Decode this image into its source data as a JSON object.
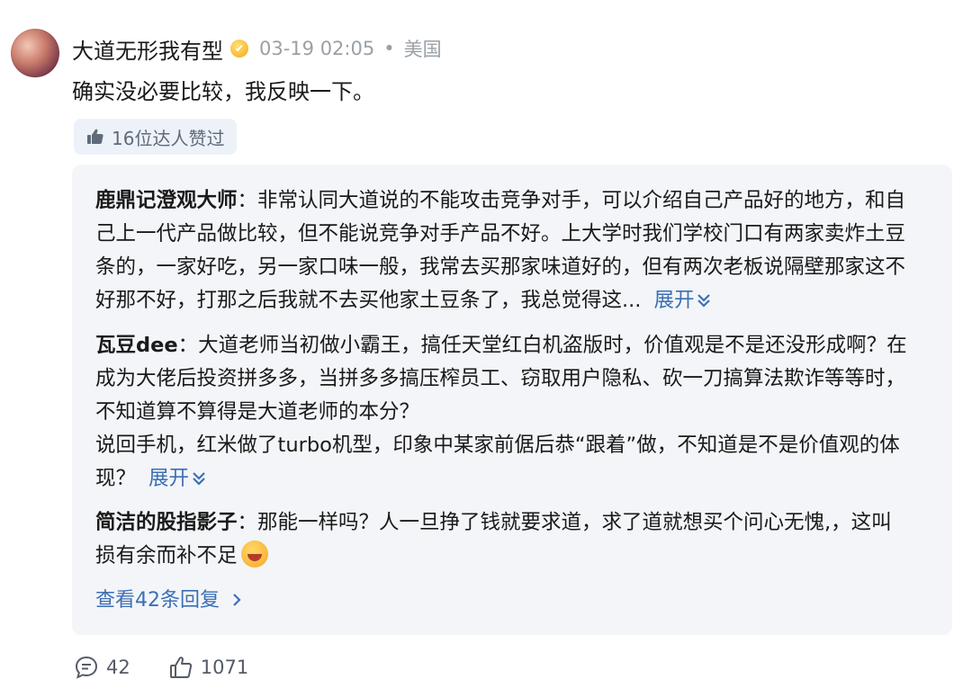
{
  "comment": {
    "username": "大道无形我有型",
    "timestamp": "03-19 02:05",
    "separator": "•",
    "location": "美国",
    "text": "确实没必要比较，我反映一下。",
    "likes_by_experts": "16位达人赞过"
  },
  "replies": [
    {
      "author": "鹿鼎记澄观大师",
      "separator": "：",
      "lines": [
        "非常认同大道说的不能攻击竞争对手，可以介绍自己产品好的地方，和自",
        "己上一代产品做比较，但不能说竞争对手产品不好。上大学时我们学校门口有两家卖炸土豆",
        "条的，一家好吃，另一家口味一般，我常去买那家味道好的，但有两次老板说隔壁那家这不",
        "好那不好，打那之后我就不去买他家土豆条了，我总觉得这..."
      ],
      "expand_label": "展开"
    },
    {
      "author": "瓦豆dee",
      "separator": "：",
      "lines": [
        "大道老师当初做小霸王，搞任天堂红白机盗版时，价值观是不是还没形成啊？在",
        "成为大佬后投资拼多多，当拼多多搞压榨员工、窃取用户隐私、砍一刀搞算法欺诈等等时，",
        "不知道算不算得是大道老师的本分？",
        "说回手机，红米做了turbo机型，印象中某家前倨后恭“跟着”做，不知道是不是价值观的体",
        "现？"
      ],
      "expand_label": "展开"
    },
    {
      "author": "简洁的股指影子",
      "separator": "：",
      "lines": [
        "那能一样吗？人一旦挣了钱就要求道，求了道就想买个问心无愧,，这叫",
        "损有余而补不足"
      ],
      "emoji": "laughing-face"
    }
  ],
  "view_more_replies": "查看42条回复",
  "footer": {
    "comment_count": "42",
    "like_count": "1071"
  },
  "colors": {
    "link": "#3c6fb5",
    "reply_background": "#f3f5f8",
    "meta_gray": "#9aa0a6"
  }
}
